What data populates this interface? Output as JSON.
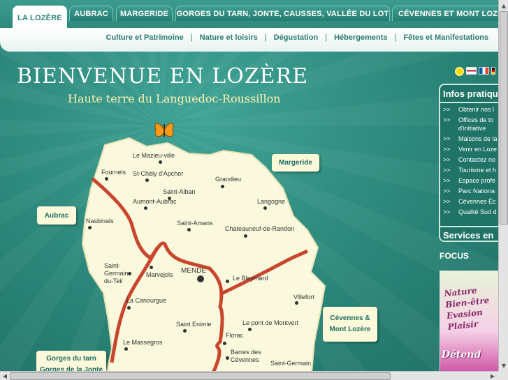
{
  "nav": {
    "tabs": [
      {
        "label": "LA LOZÈRE"
      },
      {
        "label": "AUBRAC"
      },
      {
        "label": "MARGERIDE"
      },
      {
        "label": "GORGES DU TARN, JONTE, CAUSSES, VALLÉE DU LOT"
      },
      {
        "label": "CÉVENNES ET MONT LOZÈRE"
      }
    ],
    "subnav": [
      {
        "label": "Culture et Patrimoine"
      },
      {
        "label": "Nature et loisirs"
      },
      {
        "label": "Dégustation"
      },
      {
        "label": "Hébergements"
      },
      {
        "label": "Fêtes et Manifestations"
      }
    ],
    "separator": "|"
  },
  "hero": {
    "title": "BIENVENUE EN LOZÈRE",
    "subtitle": "Haute terre du Languedoc-Roussillon"
  },
  "infos": {
    "title": "Infos pratiques",
    "arrow": ">>",
    "items": [
      {
        "label": "Obtenir nos l"
      },
      {
        "label": "Offices de to"
      },
      {
        "label": "d'initiative"
      },
      {
        "label": "Maisons de la"
      },
      {
        "label": "Venir en Loze"
      },
      {
        "label": "Contactez no"
      },
      {
        "label": "Tourisme et h"
      },
      {
        "label": "Espace profe"
      },
      {
        "label": "Parc Nationa"
      },
      {
        "label": "Cévennes Éc"
      },
      {
        "label": "Qualité Sud d"
      }
    ],
    "services": "Services en"
  },
  "focus": {
    "label": "FOCUS",
    "lines": [
      "Nature",
      "Bien-être",
      "Evasion",
      "Plaisir"
    ],
    "banner": "Détend"
  },
  "map": {
    "regions": [
      {
        "label": "Margeride"
      },
      {
        "label": "Aubrac"
      },
      {
        "label": "Cévennes &"
      },
      {
        "label": "Mont Lozère"
      },
      {
        "label": "Gorges du tarn"
      },
      {
        "label": "Gorges de la Jonte"
      }
    ],
    "towns": [
      {
        "label": "Le Mazieu-ville"
      },
      {
        "label": "Fournels"
      },
      {
        "label": "St-Chély d'Apcher"
      },
      {
        "label": "Grandieu"
      },
      {
        "label": "Saint-Alban"
      },
      {
        "label": "Aumont-Aubrac"
      },
      {
        "label": "Langogne"
      },
      {
        "label": "Nasbinals"
      },
      {
        "label": "Saint-Amans"
      },
      {
        "label": "Chateauneuf-de-Randon"
      },
      {
        "label": "Saint-"
      },
      {
        "label": "Germain-"
      },
      {
        "label": "du-Teil"
      },
      {
        "label": "Marvejols"
      },
      {
        "label": "MENDE"
      },
      {
        "label": "Le Bleymard"
      },
      {
        "label": "Villefort"
      },
      {
        "label": "La Canourgue"
      },
      {
        "label": "Saint Enimie"
      },
      {
        "label": "Le pont de Montvert"
      },
      {
        "label": "Le Massegros"
      },
      {
        "label": "Florac"
      },
      {
        "label": "Barres des"
      },
      {
        "label": "Cévennes"
      },
      {
        "label": "Saint-Germain"
      }
    ]
  },
  "colors": {
    "bg": "#2a8578",
    "panel": "#1f7367",
    "badge": "#fbf9d9",
    "road": "#c8462e"
  }
}
